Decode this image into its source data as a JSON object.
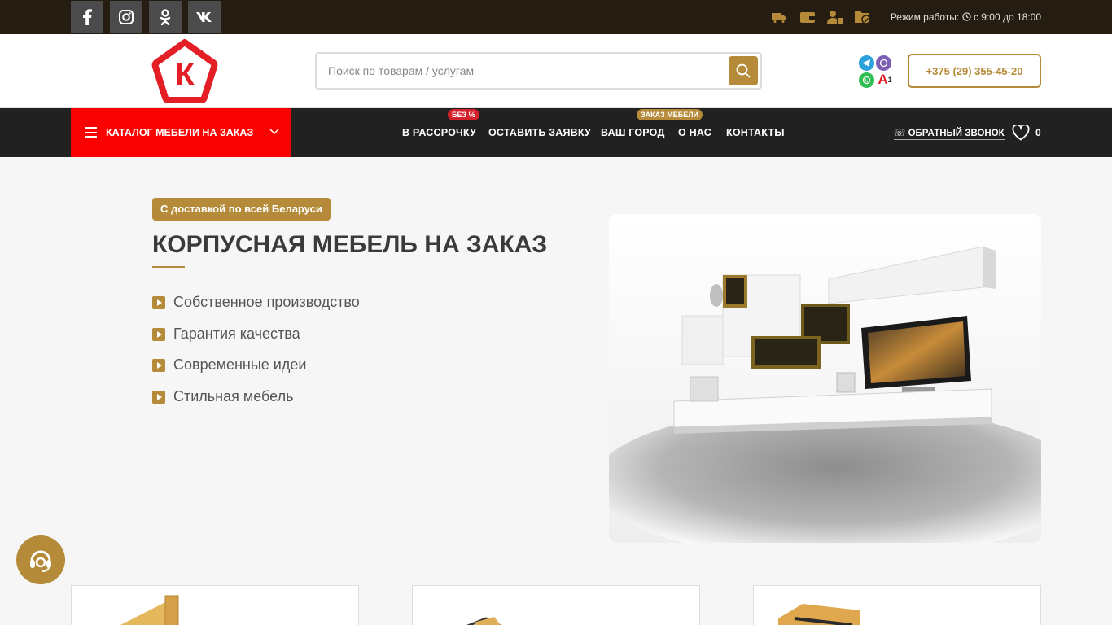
{
  "topbar": {
    "socials": [
      {
        "name": "facebook",
        "icon": "facebook-icon"
      },
      {
        "name": "instagram",
        "icon": "instagram-icon"
      },
      {
        "name": "odnoklassniki",
        "icon": "odnoklassniki-icon"
      },
      {
        "name": "vk",
        "icon": "vk-icon"
      }
    ],
    "info_icons": [
      "delivery-truck-icon",
      "wallet-icon",
      "user-lock-icon",
      "check-folder-icon"
    ],
    "hours_label": "Режим работы:",
    "hours_value": "с 9:00 до 18:00"
  },
  "header": {
    "logo_letter": "К",
    "search_placeholder": "Поиск по товарам / услугам",
    "phone": "+375 (29) 355-45-20",
    "messengers": [
      "telegram-icon",
      "viber-icon",
      "whatsapp-icon",
      "a1-icon"
    ]
  },
  "nav": {
    "catalog_label": "КАТАЛОГ МЕБЕЛИ НА ЗАКАЗ",
    "links": [
      {
        "label": "В РАССРОЧКУ",
        "badge": "БЕЗ %"
      },
      {
        "label": "ОСТАВИТЬ ЗАЯВКУ"
      },
      {
        "label": "ВАШ ГОРОД",
        "badge": "ЗАКАЗ МЕБЕЛИ"
      },
      {
        "label": "О НАС"
      },
      {
        "label": "КОНТАКТЫ"
      }
    ],
    "callback_label": "ОБРАТНЫЙ ЗВОНОК",
    "wishlist_count": "0"
  },
  "hero": {
    "badge": "С доставкой по всей Беларуси",
    "title": "КОРПУСНАЯ МЕБЕЛЬ НА ЗАКАЗ",
    "features": [
      "Собственное производство",
      "Гарантия качества",
      "Современные идеи",
      "Стильная мебель"
    ]
  },
  "colors": {
    "accent": "#b58a38",
    "topbar": "#261d12",
    "nav": "#212121",
    "catalog": "#fb0202",
    "badge_red": "#d3202b"
  }
}
